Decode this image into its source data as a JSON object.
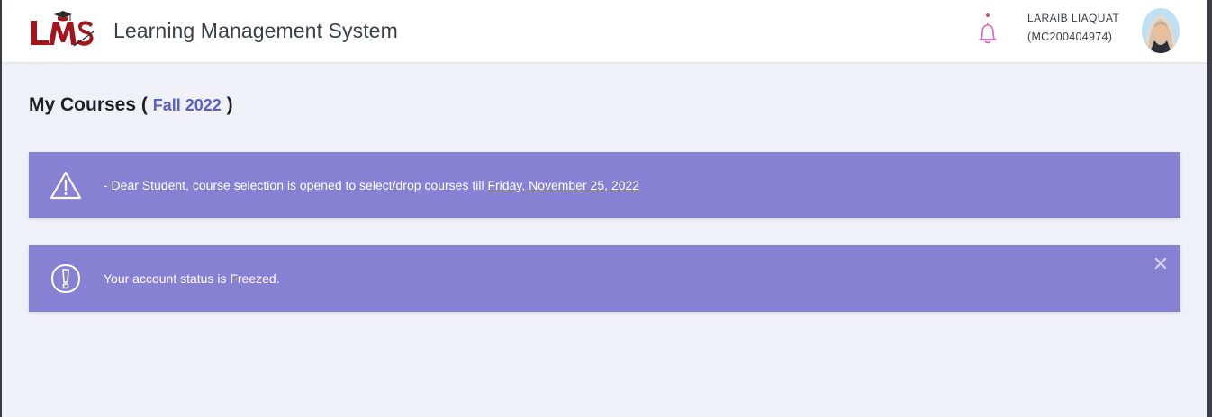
{
  "header": {
    "logo_text": "LMS",
    "app_title": "Learning Management System",
    "user_name": "LARAIB LIAQUAT",
    "user_id": "(MC200404974)"
  },
  "page": {
    "heading": "My Courses",
    "term": "Fall 2022"
  },
  "alerts": [
    {
      "icon": "warning-triangle-icon",
      "text": "- Dear Student, course selection is opened to select/drop courses till",
      "date": "Friday, November 25, 2022"
    },
    {
      "icon": "exclamation-badge-icon",
      "text": "Your account status is Freezed."
    }
  ],
  "colors": {
    "alert_bg": "#8781d3",
    "accent": "#5a5fc9",
    "logo_red": "#a3151c",
    "bell": "#d862c7",
    "page_bg": "#f0f1f6"
  }
}
